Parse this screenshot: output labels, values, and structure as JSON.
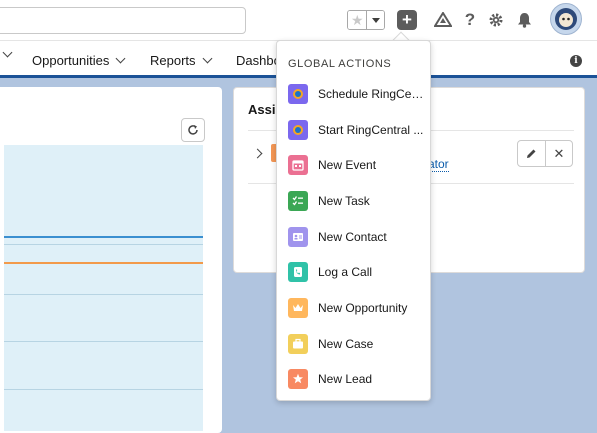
{
  "header": {
    "favorites_star_glyph": "★",
    "help_glyph": "?"
  },
  "nav": {
    "items": [
      {
        "label": "Opportunities"
      },
      {
        "label": "Reports"
      },
      {
        "label": "Dashbo"
      }
    ],
    "info_glyph": "i"
  },
  "assistant_card": {
    "title": "Assi",
    "link_text": "ator"
  },
  "global_actions": {
    "heading": "GLOBAL ACTIONS",
    "items": [
      {
        "label": "Schedule RingCen...",
        "icon": "ringcentral-icon",
        "color": "#7b68ee"
      },
      {
        "label": "Start RingCentral ...",
        "icon": "ringcentral-icon",
        "color": "#7b68ee"
      },
      {
        "label": "New Event",
        "icon": "calendar-icon",
        "color": "#eb7092"
      },
      {
        "label": "New Task",
        "icon": "task-icon",
        "color": "#3ba755"
      },
      {
        "label": "New Contact",
        "icon": "contact-icon",
        "color": "#a094ed"
      },
      {
        "label": "Log a Call",
        "icon": "phone-icon",
        "color": "#30c2a8"
      },
      {
        "label": "New Opportunity",
        "icon": "crown-icon",
        "color": "#ffb75d"
      },
      {
        "label": "New Case",
        "icon": "briefcase-icon",
        "color": "#f2cf5b"
      },
      {
        "label": "New Lead",
        "icon": "lead-star-icon",
        "color": "#f88962"
      }
    ]
  }
}
